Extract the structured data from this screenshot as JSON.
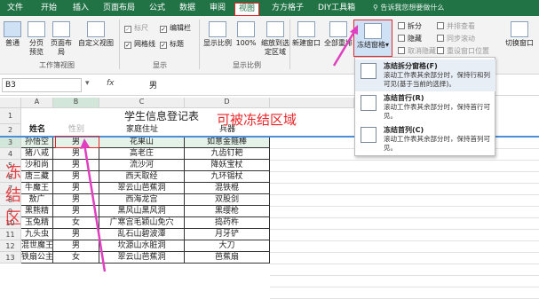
{
  "tabs": [
    "文件",
    "开始",
    "插入",
    "页面布局",
    "公式",
    "数据",
    "审阅",
    "视图",
    "方方格子",
    "DIY工具箱"
  ],
  "tell_me": "告诉我您想要做什么",
  "ribbon": {
    "views": {
      "normal": "普通",
      "pagebreak": "分页预览",
      "pagelayout": "页面布局",
      "custom": "自定义视图",
      "group": "工作簿视图"
    },
    "show": {
      "ruler": "标尺",
      "gridlines": "网格线",
      "formulabar": "编辑栏",
      "headings": "标题",
      "group": "显示"
    },
    "zoom": {
      "zoom": "显示比例",
      "hundred": "100%",
      "selection": "缩放到选定区域",
      "group": "显示比例"
    },
    "window": {
      "newwin": "新建窗口",
      "arrange": "全部重排",
      "freeze": "冻结窗格",
      "split": "拆分",
      "hide": "隐藏",
      "unhide": "取消隐藏",
      "side": "并排查看",
      "sync": "同步滚动",
      "reset": "重设窗口位置",
      "switch": "切换窗口"
    }
  },
  "namebox": "B3",
  "fx": "fx",
  "formula": "男",
  "columns": [
    "A",
    "B",
    "C",
    "D"
  ],
  "rows": [
    "1",
    "2",
    "3",
    "4",
    "5",
    "6",
    "7",
    "8",
    "9",
    "10",
    "11",
    "12",
    "13"
  ],
  "title": "学生信息登记表",
  "headers": [
    "姓名",
    "性别",
    "家庭住址",
    "兵器"
  ],
  "table": [
    [
      "孙悟空",
      "男",
      "花果山",
      "如意金箍棒"
    ],
    [
      "猪八戒",
      "男",
      "高老庄",
      "九齿钉耙"
    ],
    [
      "沙和尚",
      "男",
      "流沙河",
      "降妖宝杖"
    ],
    [
      "唐三藏",
      "男",
      "西天取经",
      "九环锡杖"
    ],
    [
      "牛魔王",
      "男",
      "翠云山芭蕉洞",
      "混铁棍"
    ],
    [
      "敖广",
      "男",
      "西海龙宫",
      "双股剑"
    ],
    [
      "黑熊精",
      "男",
      "黑风山黑风洞",
      "黑缨枪"
    ],
    [
      "玉兔精",
      "女",
      "广寒宫毛颖山免穴",
      "捣药杵"
    ],
    [
      "九头虫",
      "男",
      "乱石山碧波潭",
      "月牙铲"
    ],
    [
      "混世魔王",
      "男",
      "坎源山水脏洞",
      "大刀"
    ],
    [
      "铁扇公主",
      "女",
      "翠云山芭蕉洞",
      "芭蕉扇"
    ]
  ],
  "annotations": {
    "freeze_area": "可被冻结区域",
    "vertical": [
      "冻",
      "结",
      "区"
    ]
  },
  "menu": [
    {
      "title": "冻结拆分窗格(F)",
      "desc": "滚动工作表其余部分时，保持行和列可见(基于当前的选择)。"
    },
    {
      "title": "冻结首行(R)",
      "desc": "滚动工作表其余部分时，保持首行可见。"
    },
    {
      "title": "冻结首列(C)",
      "desc": "滚动工作表其余部分时，保持首列可见。"
    }
  ],
  "colors": {
    "accent": "#217346",
    "highlight": "#e8262a",
    "arrow": "#e040c0"
  }
}
